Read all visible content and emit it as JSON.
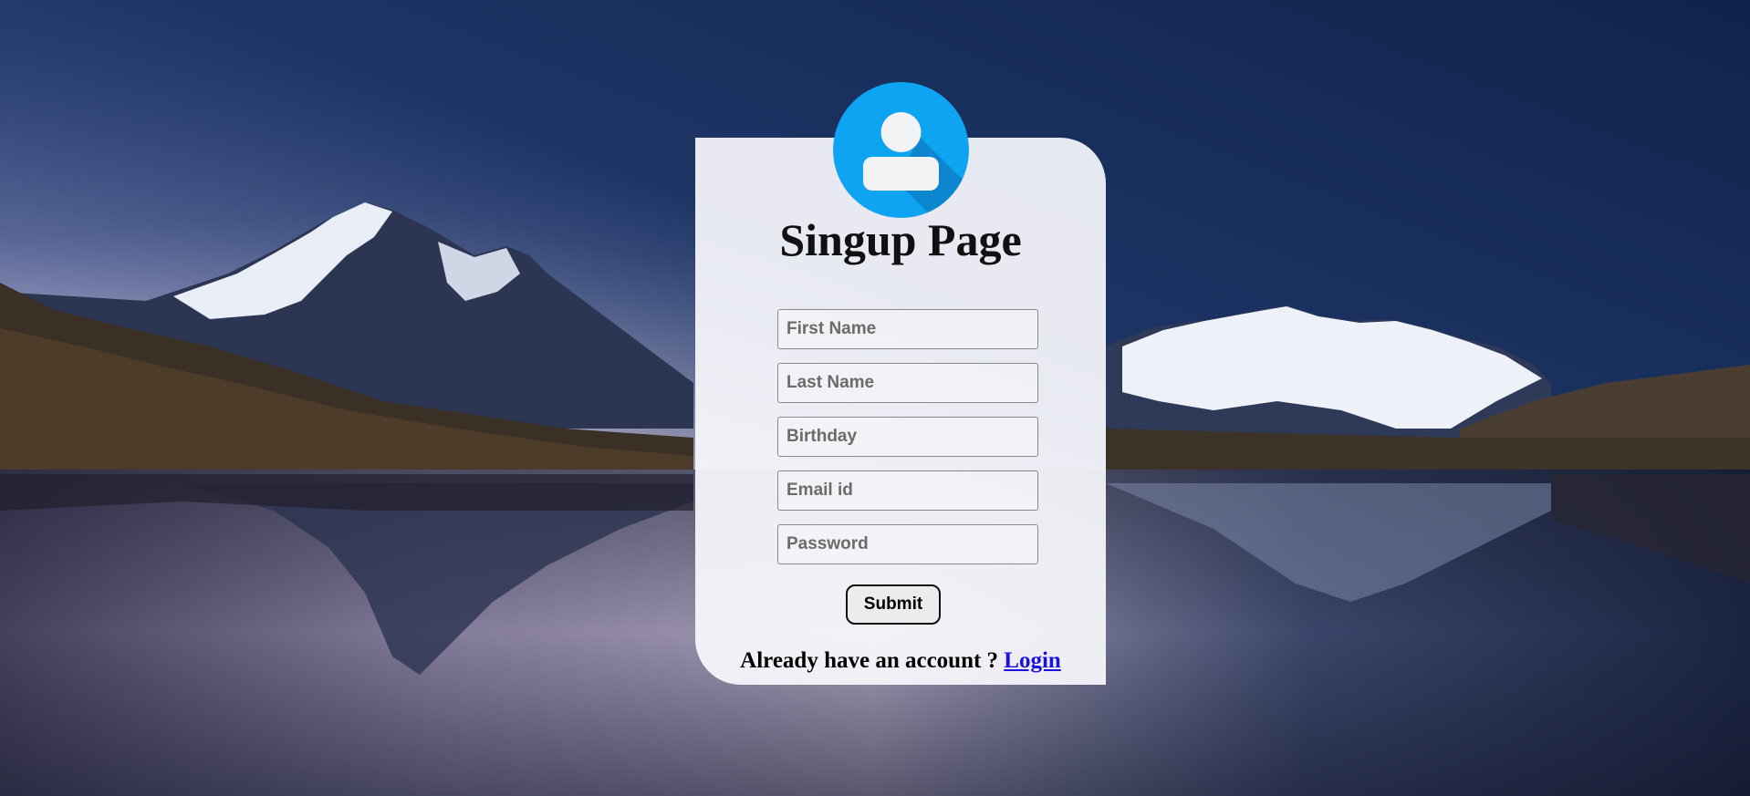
{
  "page": {
    "title": "Singup Page"
  },
  "form": {
    "fields": [
      {
        "placeholder": "First Name",
        "value": ""
      },
      {
        "placeholder": "Last Name",
        "value": ""
      },
      {
        "placeholder": "Birthday",
        "value": ""
      },
      {
        "placeholder": "Email id",
        "value": ""
      },
      {
        "placeholder": "Password",
        "value": ""
      }
    ],
    "submit_label": "Submit"
  },
  "footer": {
    "text": "Already have an account ? ",
    "link_label": "Login"
  },
  "icons": {
    "avatar": "user-icon"
  },
  "colors": {
    "avatar_bg": "#0fa4f2",
    "link": "#1a12e0",
    "sky_top": "#132850",
    "lake": "#1c2a4d"
  }
}
